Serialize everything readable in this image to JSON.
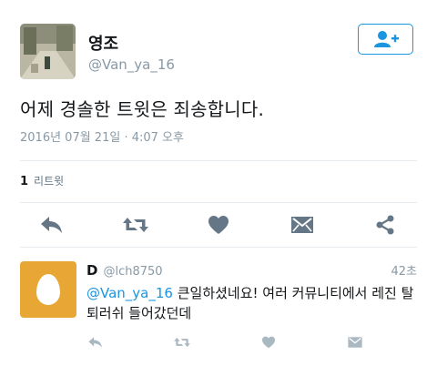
{
  "colors": {
    "icon": "#657786",
    "accent": "#1b95e0",
    "egg_bg": "#e8a734",
    "muted": "#8899a6"
  },
  "tweet": {
    "display_name": "영조",
    "handle": "@Van_ya_16",
    "text": "어제 경솔한 트윗은 죄송합니다.",
    "timestamp": "2016년 07월 21일 · 4:07 오후",
    "retweet_count": "1",
    "retweet_label": "리트윗",
    "follow_icon": "add-user-icon",
    "actions": [
      "reply-icon",
      "retweet-icon",
      "like-icon",
      "message-icon",
      "share-icon"
    ]
  },
  "reply": {
    "display_name": "D",
    "handle": "@lch8750",
    "time": "42초",
    "mention": "@Van_ya_16",
    "text": " 큰일하셨네요! 여러 커뮤니티에서 레진 탈퇴러쉬 들어갔던데",
    "actions": [
      "reply-icon",
      "retweet-icon",
      "like-icon",
      "message-icon"
    ]
  }
}
